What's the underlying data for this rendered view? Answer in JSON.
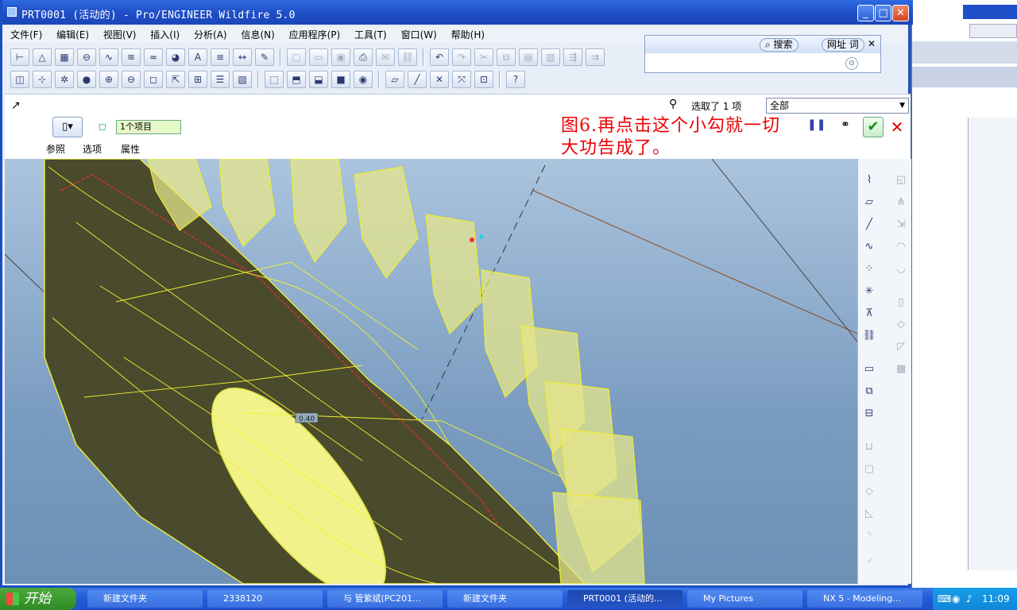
{
  "window": {
    "title": "PRT0001 (活动的) - Pro/ENGINEER Wildfire 5.0",
    "minimize": "_",
    "maximize": "□",
    "close": "✕"
  },
  "menu": [
    "文件(F)",
    "编辑(E)",
    "视图(V)",
    "插入(I)",
    "分析(A)",
    "信息(N)",
    "应用程序(P)",
    "工具(T)",
    "窗口(W)",
    "帮助(H)"
  ],
  "search": {
    "search_label": "搜索",
    "url_label": "网址",
    "word_label": "词"
  },
  "dashboard": {
    "selection_label": "选取了 1 项",
    "filter_value": "全部",
    "collector_value": "1个项目",
    "tabs": [
      "参照",
      "选项",
      "属性"
    ]
  },
  "annotation": {
    "line1": "图6.再点击这个小勾就一切",
    "line2": "大功告成了。"
  },
  "viewport": {
    "dim_label": "0.40"
  },
  "taskbar": {
    "start_label": "开始",
    "items": [
      "新建文件夹",
      "2338120",
      "与 管紫斌(PC201...",
      "新建文件夹",
      "PRT0001 (活动的...",
      "My Pictures",
      "NX 5 - Modeling..."
    ],
    "clock": "11:09"
  },
  "colors": {
    "titlebar": "#1f4fc8",
    "model_fill": "#4a4a2c",
    "wireframe": "#ffff40",
    "annotation": "#ee0000"
  }
}
